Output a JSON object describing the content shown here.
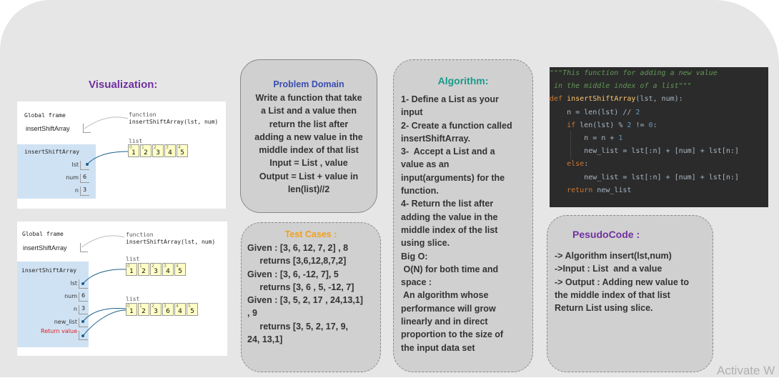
{
  "visualization": {
    "title": "Visualization:",
    "panel1": {
      "global_frame_label": "Global frame",
      "global_var": "insertShiftArray",
      "function_tag": "function",
      "function_sig": "insertShiftArray(lst, num)",
      "frame_name": "insertShiftArray",
      "vars": [
        {
          "name": "lst",
          "value": ""
        },
        {
          "name": "num",
          "value": "6"
        },
        {
          "name": "n",
          "value": "3"
        }
      ],
      "list_label": "list",
      "list_indices": [
        "0",
        "1",
        "2",
        "3",
        "4"
      ],
      "list_values": [
        "1",
        "2",
        "3",
        "4",
        "5"
      ]
    },
    "panel2": {
      "global_frame_label": "Global frame",
      "global_var": "insertShiftArray",
      "function_tag": "function",
      "function_sig": "insertShiftArray(lst, num)",
      "frame_name": "insertShiftArray",
      "vars": [
        {
          "name": "lst",
          "value": ""
        },
        {
          "name": "num",
          "value": "6"
        },
        {
          "name": "n",
          "value": "3"
        },
        {
          "name": "new_list",
          "value": ""
        },
        {
          "name": "Return value",
          "value": ""
        }
      ],
      "list1_label": "list",
      "list1_indices": [
        "0",
        "1",
        "2",
        "3",
        "4"
      ],
      "list1_values": [
        "1",
        "2",
        "3",
        "4",
        "5"
      ],
      "list2_label": "list",
      "list2_indices": [
        "0",
        "1",
        "2",
        "3",
        "4",
        "5"
      ],
      "list2_values": [
        "1",
        "2",
        "3",
        "6",
        "4",
        "5"
      ]
    }
  },
  "problem_domain": {
    "title": "Problem Domain",
    "lines": [
      "Write a function that take",
      "a List and a value then",
      "return the list after",
      "adding a new value in the",
      "middle index of that list",
      "Input = List , value",
      "Output = List +  value in",
      "len(list)//2"
    ]
  },
  "test_cases": {
    "title": "Test Cases :",
    "lines": [
      "Given : [3, 6, 12, 7, 2] , 8",
      "     returns [3,6,12,8,7,2]",
      "Given : [3, 6, -12, 7], 5",
      "     returns [3, 6 , 5, -12, 7]",
      "Given : [3, 5, 2, 17 , 24,13,1]",
      ", 9",
      "     returns [3, 5, 2, 17, 9,",
      "24, 13,1]"
    ]
  },
  "algorithm": {
    "title": "Algorithm:",
    "lines": [
      "1- Define a List as your",
      "input",
      "2- Create a function called",
      "insertShiftArray.",
      "3-  Accept a List and a",
      "value as an",
      "input(arguments) for the",
      "function.",
      "4- Return the list after",
      "adding the value in the",
      "middle index of the list",
      "using slice.",
      "Big O:",
      " O(N) for both time and",
      "space :",
      " An algorithm whose",
      "performance will grow",
      "linearly and in direct",
      "proportion to the size of",
      "the input data set"
    ]
  },
  "code": {
    "lines": [
      [
        {
          "t": "\"\"\"This function for adding a new value",
          "c": "doc"
        }
      ],
      [
        {
          "t": " in the middle index of a list\"\"\"",
          "c": "doc"
        }
      ],
      [
        {
          "t": "def ",
          "c": "kw"
        },
        {
          "t": "insertShiftArray",
          "c": "fn"
        },
        {
          "t": "(lst, num):",
          "c": "tx"
        }
      ],
      [
        {
          "t": "    n = len(lst) // ",
          "c": "tx"
        },
        {
          "t": "2",
          "c": "num"
        }
      ],
      [
        {
          "t": "    ",
          "c": "tx"
        },
        {
          "t": "if ",
          "c": "kw"
        },
        {
          "t": "len(lst) % ",
          "c": "tx"
        },
        {
          "t": "2",
          "c": "num"
        },
        {
          "t": " != ",
          "c": "tx"
        },
        {
          "t": "0",
          "c": "num"
        },
        {
          "t": ":",
          "c": "tx"
        }
      ],
      [
        {
          "t": "        n = n + ",
          "c": "tx"
        },
        {
          "t": "1",
          "c": "num"
        }
      ],
      [
        {
          "t": "        new_list = lst[:n] + [num] + lst[n:]",
          "c": "tx"
        }
      ],
      [
        {
          "t": "    ",
          "c": "tx"
        },
        {
          "t": "else",
          "c": "kw"
        },
        {
          "t": ":",
          "c": "tx"
        }
      ],
      [
        {
          "t": "        new_list = lst[:n] + [num] + lst[n:]",
          "c": "tx"
        }
      ],
      [
        {
          "t": "    ",
          "c": "tx"
        },
        {
          "t": "return ",
          "c": "kw"
        },
        {
          "t": "new_list",
          "c": "tx"
        }
      ]
    ]
  },
  "pseudocode": {
    "title": "PesudoCode :",
    "lines": [
      "-> Algorithm insert(lst,num)",
      "->Input : List  and a value",
      "-> Output : Adding new value to",
      "the middle index of that list",
      "Return List using slice."
    ]
  },
  "watermark": "Activate W",
  "colors": {
    "viz_title": "#7030a0",
    "problem_title": "#3a4db0",
    "test_title": "#f0a020",
    "algo_title": "#1a9a8a",
    "pseudo_title": "#7030a0",
    "return_label": "#e02020",
    "arrow": "#1a5f8a"
  }
}
